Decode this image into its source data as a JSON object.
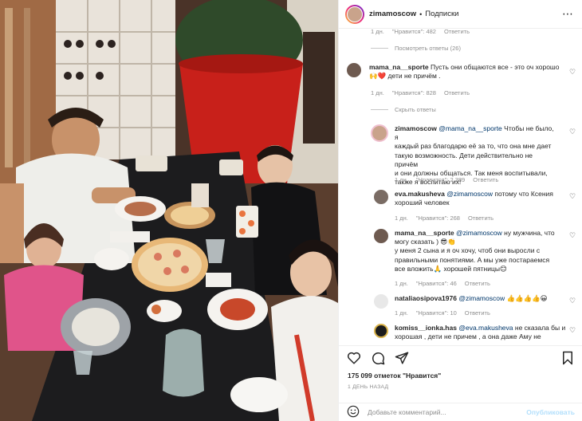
{
  "header": {
    "username": "zimamoscow",
    "separator": "•",
    "follow_label": "Подписки",
    "more_icon": "more-icon"
  },
  "comments": {
    "top_meta": {
      "time": "1 дн.",
      "likes": "\"Нравится\": 482",
      "reply": "Ответить"
    },
    "view_replies": "Посмотреть ответы (26)",
    "c1": {
      "user": "mama_na__sporte",
      "text_a": "Пусть они общаются все - это оч хорошо",
      "text_b": "дети не причём .",
      "time": "1 дн.",
      "likes": "\"Нравится\": 828",
      "reply": "Ответить"
    },
    "hide_replies": "Скрыть ответы",
    "r1": {
      "user": "zimamoscow",
      "mention": "@mama_na__sporte",
      "lines": [
        "Чтобы не было, я",
        "каждый раз благодарю её за то, что она мне дает",
        "такую возможность. Дети действительно не причём",
        "и они должны общаться. Так меня воспитывали,",
        "также я воспитаю их!"
      ],
      "time": "1 дн.",
      "likes": "\"Нравится\": 2 389",
      "reply": "Ответить"
    },
    "r2": {
      "user": "eva.makusheva",
      "mention": "@zimamoscow",
      "text_a": "потому что Ксения",
      "text_b": "хороший человек",
      "time": "1 дн.",
      "likes": "\"Нравится\": 268",
      "reply": "Ответить"
    },
    "r3": {
      "user": "mama_na__sporte",
      "mention": "@zimamoscow",
      "lines": [
        "ну мужчина, что",
        "могу сказать ) 😎👏",
        "у меня 2 сына и я оч хочу, чтоб они выросли с",
        "правильными понятиями. А мы уже постараемся",
        "все вложить🙏 хорошей пятницы😊"
      ],
      "time": "1 дн.",
      "likes": "\"Нравится\": 46",
      "reply": "Ответить"
    },
    "r4": {
      "user": "nataliaosipova1976",
      "mention": "@zimamoscow",
      "text_a": "👍👍👍👍😀",
      "time": "1 дн.",
      "likes": "\"Нравится\": 10",
      "reply": "Ответить"
    },
    "r5": {
      "user": "komiss__ionka.has",
      "mention": "@eva.makusheva",
      "text_a": "не сказала бы и",
      "text_b": "хорошая , дети не причем , а она даже Аму не"
    }
  },
  "actions": {
    "likes_count": "175 099 отметок \"Нравится\"",
    "posted": "1 ДЕНЬ НАЗАД",
    "comment_placeholder": "Добавьте комментарий...",
    "post_label": "Опубликовать",
    "icons": [
      "heart-icon",
      "comment-icon",
      "share-icon",
      "bookmark-icon",
      "emoji-icon"
    ]
  },
  "colors": {
    "mention": "#00376b",
    "secondary_text": "#8e8e8e",
    "post_button": "#b2dffc",
    "border": "#efefef"
  }
}
